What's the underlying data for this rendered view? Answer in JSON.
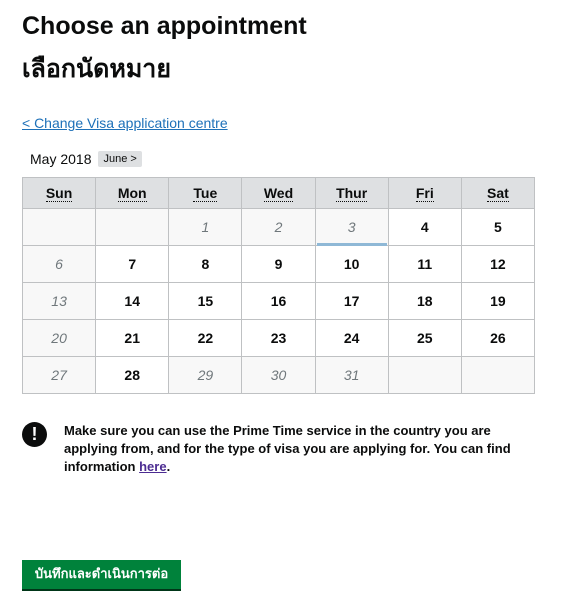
{
  "page": {
    "title": "Choose an appointment",
    "subtitle": "เลือกนัดหมาย",
    "back_link": "< Change Visa application centre"
  },
  "calendar": {
    "current_month": "May 2018",
    "next_month_label": "June >",
    "weekdays": [
      "Sun",
      "Mon",
      "Tue",
      "Wed",
      "Thur",
      "Fri",
      "Sat"
    ],
    "weeks": [
      [
        "",
        "",
        "1",
        "2",
        "3",
        "4",
        "5"
      ],
      [
        "6",
        "7",
        "8",
        "9",
        "10",
        "11",
        "12"
      ],
      [
        "13",
        "14",
        "15",
        "16",
        "17",
        "18",
        "19"
      ],
      [
        "20",
        "21",
        "22",
        "23",
        "24",
        "25",
        "26"
      ],
      [
        "27",
        "28",
        "29",
        "30",
        "31",
        "",
        ""
      ]
    ]
  },
  "notice": {
    "icon": "!",
    "text_before": "Make sure you can use the Prime Time service in the country you are applying from, and for the type of visa you are applying for. You can find information ",
    "link_text": "here",
    "text_after": "."
  },
  "actions": {
    "submit_label": "บันทึกและดำเนินการต่อ"
  }
}
